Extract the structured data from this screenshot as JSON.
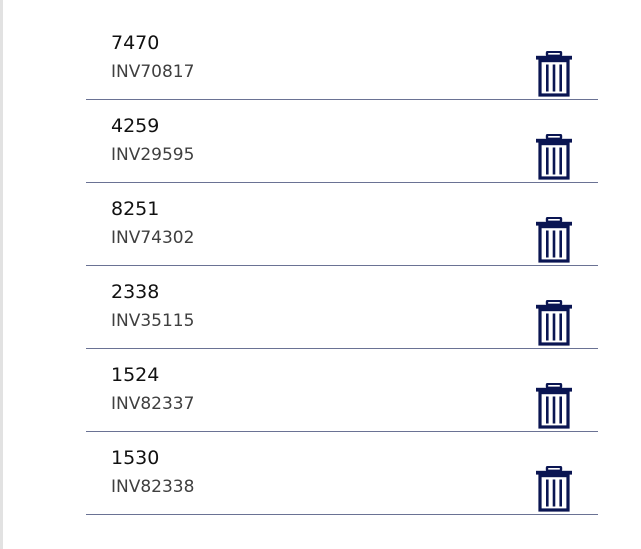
{
  "gallery": {
    "items": [
      {
        "title": "7470",
        "subtitle": "INV70817",
        "icon": "trash-icon"
      },
      {
        "title": "4259",
        "subtitle": "INV29595",
        "icon": "trash-icon"
      },
      {
        "title": "8251",
        "subtitle": "INV74302",
        "icon": "trash-icon"
      },
      {
        "title": "2338",
        "subtitle": "INV35115",
        "icon": "trash-icon"
      },
      {
        "title": "1524",
        "subtitle": "INV82337",
        "icon": "trash-icon"
      },
      {
        "title": "1530",
        "subtitle": "INV82338",
        "icon": "trash-icon"
      }
    ]
  },
  "colors": {
    "icon": "#0a1552",
    "separator": "#6a7294",
    "title_text": "#111111",
    "subtitle_text": "#3f3f3f"
  }
}
